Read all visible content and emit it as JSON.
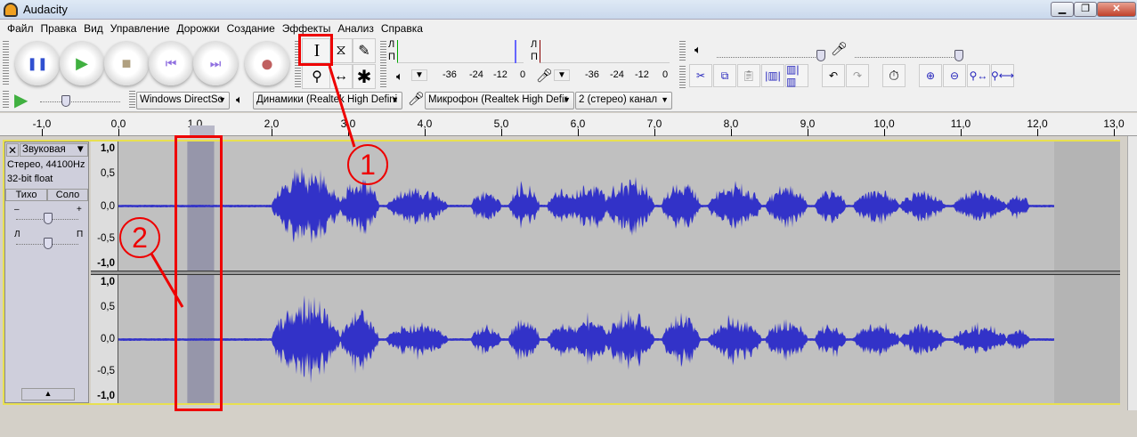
{
  "window": {
    "title": "Audacity",
    "minimize": "▁",
    "maximize": "❐",
    "close": "✕"
  },
  "menu": [
    "Файл",
    "Правка",
    "Вид",
    "Управление",
    "Дорожки",
    "Создание",
    "Эффекты",
    "Анализ",
    "Справка"
  ],
  "transport": {
    "pause": "❚❚",
    "play": "▶",
    "stop": "■",
    "skip_start": "⏮",
    "skip_end": "⏭",
    "record": "●"
  },
  "tools": {
    "selection": "I",
    "envelope": "⧖",
    "draw": "✎",
    "zoom": "⚲",
    "timeshift": "↔",
    "multi": "✱"
  },
  "meters": {
    "left": "Л",
    "right": "П",
    "scale": [
      "-36",
      "-24",
      "-12",
      "0"
    ]
  },
  "devices": {
    "host": "Windows DirectSc",
    "output": "Динамики (Realtek High Defini",
    "input": "Микрофон (Realtek High Defir",
    "channels": "2 (стерео) канал"
  },
  "ruler": {
    "ticks": [
      "-1,0",
      "0,0",
      "1,0",
      "2,0",
      "3,0",
      "4,0",
      "5,0",
      "6,0",
      "7,0",
      "8,0",
      "9,0",
      "10,0",
      "11,0",
      "12,0",
      "13,0"
    ]
  },
  "track": {
    "name": "Звуковая",
    "info1": "Стерео, 44100Hz",
    "info2": "32-bit float",
    "mute": "Тихо",
    "solo": "Соло",
    "gain_minus": "–",
    "gain_plus": "+",
    "pan_left": "Л",
    "pan_right": "П",
    "collapse": "▲",
    "yaxis": [
      "1,0",
      "0,5",
      "0,0",
      "-0,5",
      "-1,0"
    ]
  },
  "selection": {
    "start_s": 0.9,
    "end_s": 1.25
  },
  "annotations": {
    "one": "1",
    "two": "2",
    "color": "#e00000"
  },
  "colors": {
    "waveform": "#3232c8",
    "selection": "#9696aa",
    "track_bg": "#c0c0c0"
  }
}
